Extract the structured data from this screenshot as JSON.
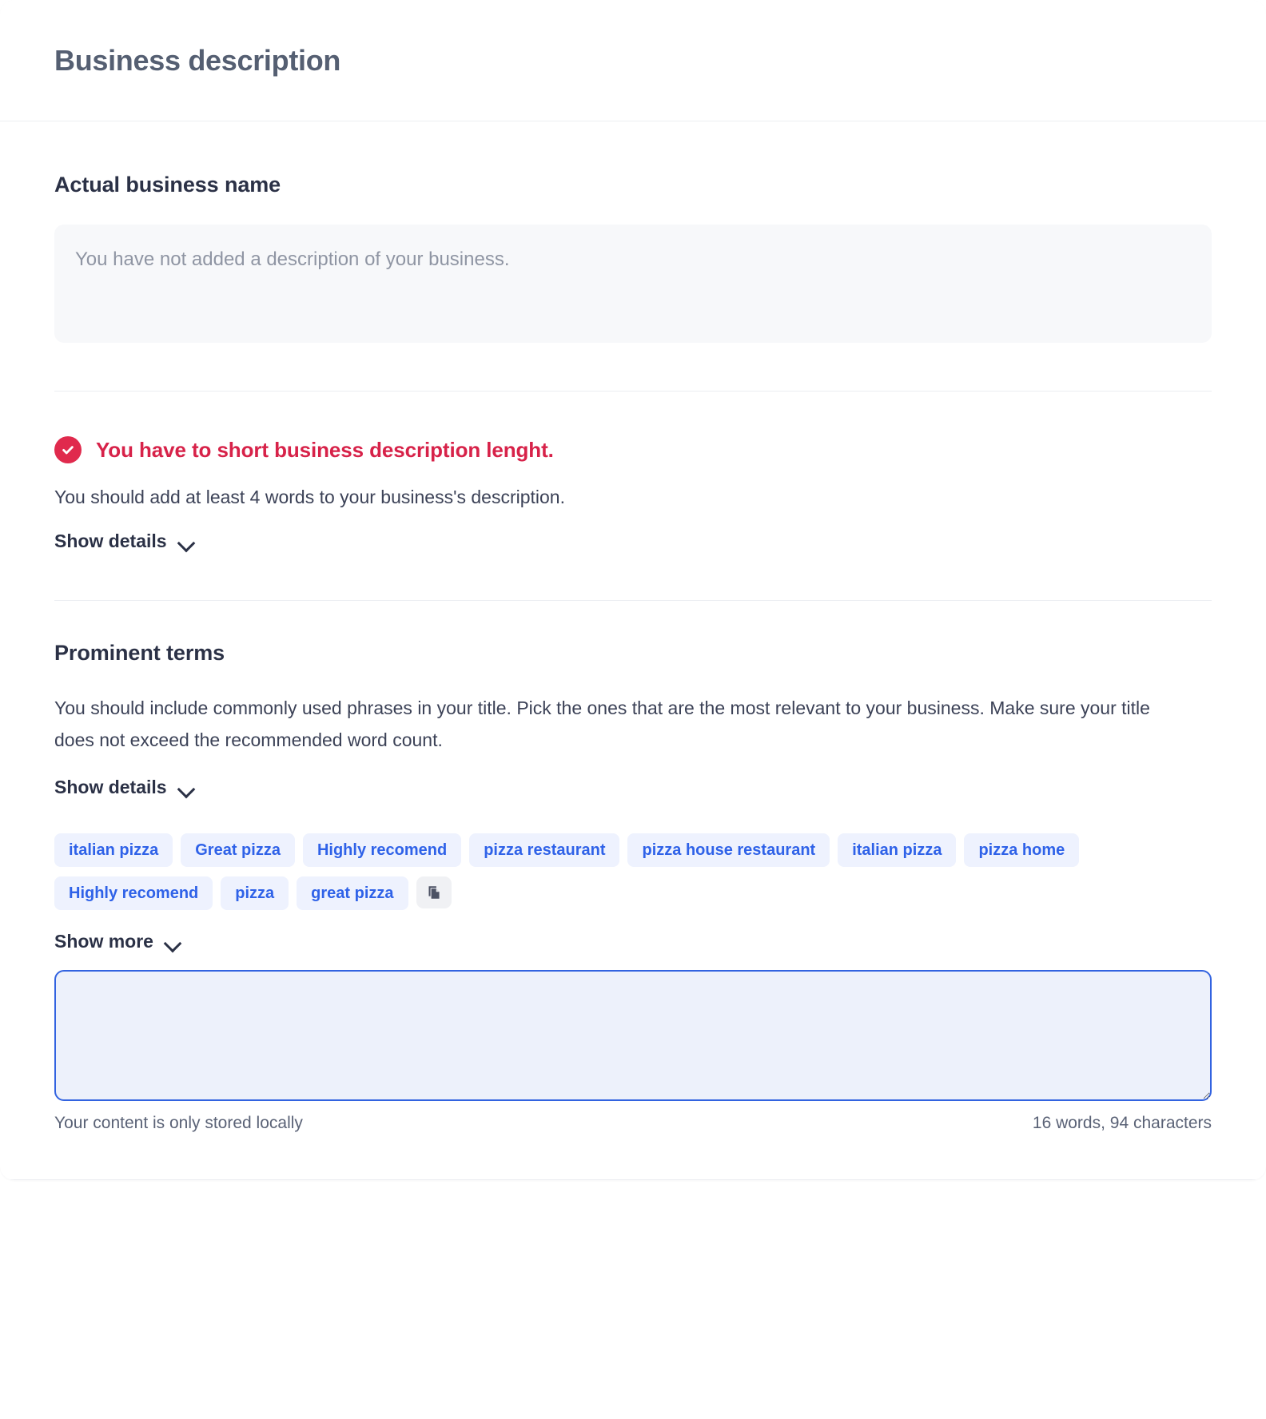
{
  "header": {
    "title": "Business description"
  },
  "actual_business": {
    "title": "Actual business name",
    "description_placeholder": "You have not added a description of your business."
  },
  "alert": {
    "icon": "check-circle-icon",
    "title": "You have to short business description lenght.",
    "description": "You should add at least 4 words to your business's description.",
    "toggle_label": "Show details",
    "toggle_icon": "chevron-down-icon",
    "color": "#d72249"
  },
  "prominent_terms": {
    "title": "Prominent terms",
    "description": "You should include commonly used phrases in your title. Pick the ones that are the most relevant to your business. Make sure your title does not exceed the recommended word count.",
    "toggle_label": "Show details",
    "toggle_icon": "chevron-down-icon",
    "tags": [
      "italian pizza",
      "Great pizza",
      "Highly recomend",
      "pizza restaurant",
      "pizza house restaurant",
      "italian pizza",
      "pizza home",
      "Highly recomend",
      "pizza",
      "great pizza"
    ],
    "copy_icon": "copy-icon",
    "show_more_label": "Show more",
    "show_more_icon": "chevron-down-icon",
    "accent_color": "#2f62e8",
    "tag_background": "#eef2fe"
  },
  "editor": {
    "value": "",
    "placeholder": "",
    "storage_note": "Your content is only stored locally",
    "counter": "16 words, 94 characters",
    "border_color": "#3263e0",
    "background_color": "#edf1fb"
  }
}
